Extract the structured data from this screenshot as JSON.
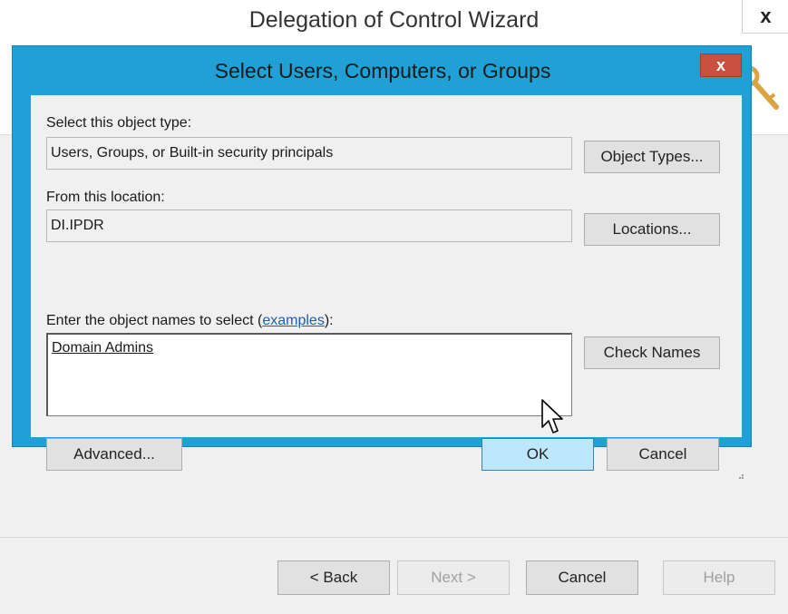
{
  "wizard": {
    "title": "Delegation of Control Wizard",
    "close_label": "x",
    "buttons": {
      "back": "< Back",
      "next": "Next >",
      "cancel": "Cancel",
      "help": "Help"
    }
  },
  "dialog": {
    "title": "Select Users, Computers, or Groups",
    "close_label": "x",
    "object_type": {
      "label": "Select this object type:",
      "value": "Users, Groups, or Built-in security principals",
      "button": "Object Types..."
    },
    "location": {
      "label": "From this location:",
      "value": "DI.IPDR",
      "button": "Locations..."
    },
    "object_names": {
      "label_prefix": "Enter the object names to select (",
      "label_link": "examples",
      "label_suffix": "):",
      "value": "Domain Admins",
      "button": "Check Names"
    },
    "buttons": {
      "advanced": "Advanced...",
      "ok": "OK",
      "cancel": "Cancel"
    }
  },
  "colors": {
    "dialog_frame": "#1fa1d6",
    "close_button": "#c7503f",
    "ok_button_hover": "#bee6fd",
    "link": "#1a5fb4"
  },
  "icons": [
    "key-icon",
    "mouse-pointer-icon",
    "close-icon",
    "resize-grip-icon"
  ]
}
